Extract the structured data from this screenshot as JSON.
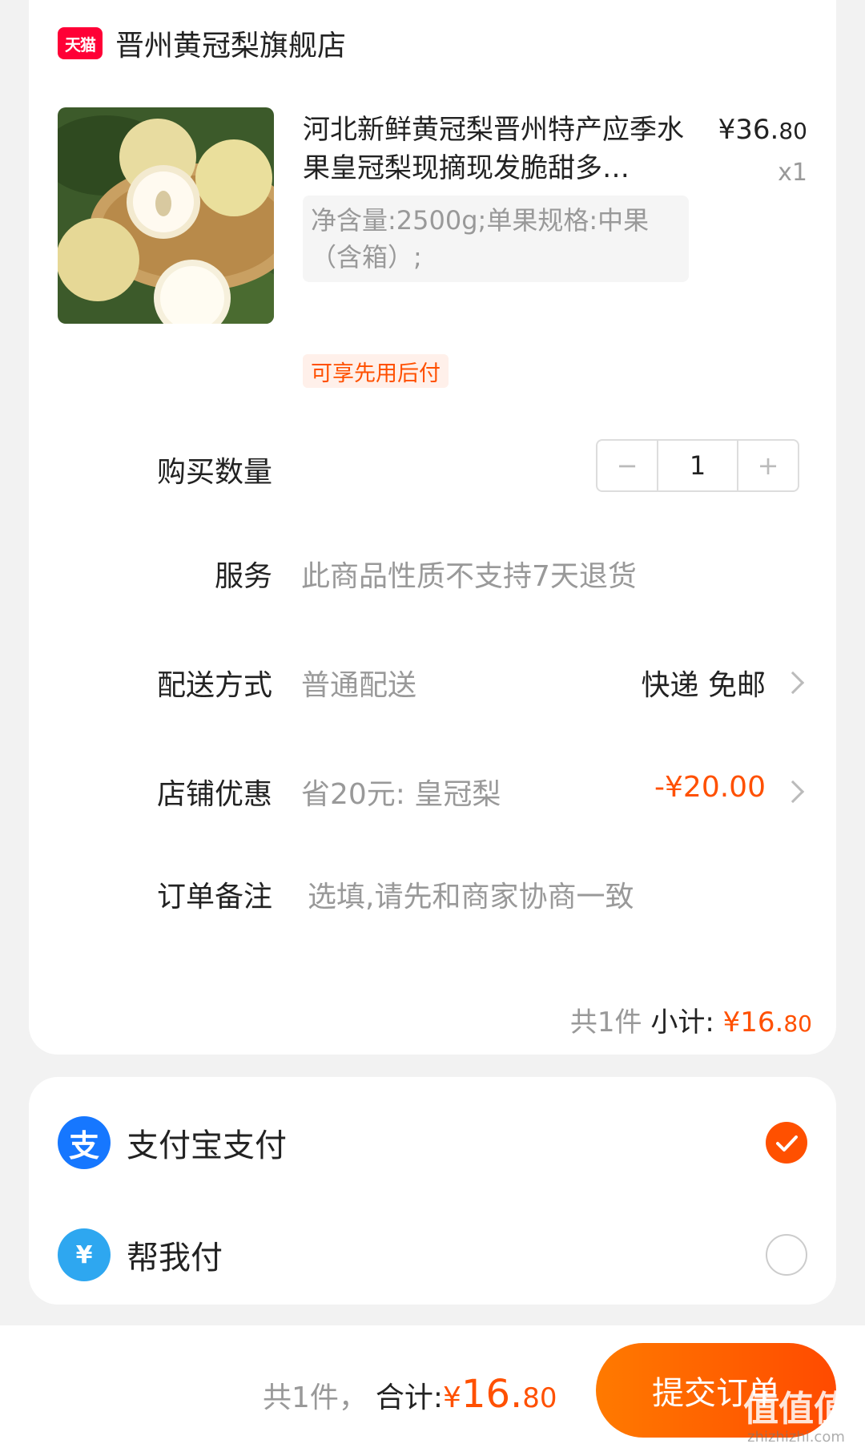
{
  "store": {
    "logo_text": "天猫",
    "name": "晋州黄冠梨旗舰店"
  },
  "product": {
    "title": "河北新鲜黄冠梨晋州特产应季水果皇冠梨现摘现发脆甜多…",
    "spec": "净含量:2500g;单果规格:中果（含箱）;",
    "price_main": "¥36.",
    "price_cents": "80",
    "quantity_label": "x1",
    "badge": "可享先用后付"
  },
  "rows": {
    "quantity": {
      "label": "购买数量",
      "value": "1",
      "minus": "−",
      "plus": "+"
    },
    "service": {
      "label": "服务",
      "value": "此商品性质不支持7天退货"
    },
    "delivery": {
      "label": "配送方式",
      "value": "普通配送",
      "right": "快递 免邮"
    },
    "coupon": {
      "label": "店铺优惠",
      "value": "省20元: 皇冠梨",
      "right": "-¥20.00"
    },
    "note": {
      "label": "订单备注",
      "placeholder": "选填,请先和商家协商一致"
    }
  },
  "subtotal": {
    "count": "共1件",
    "label": "小计:",
    "price_main": "¥16.",
    "price_cents": "80"
  },
  "payment": [
    {
      "icon_char": "支",
      "label": "支付宝支付",
      "selected": true,
      "color": "#1677ff"
    },
    {
      "icon_char": "¥",
      "label": "帮我付",
      "selected": false,
      "color": "#2ea7f0"
    }
  ],
  "bottom": {
    "count": "共1件，",
    "total_label": "合计:",
    "yen": "¥",
    "total_int": "16.",
    "total_cents": "80",
    "submit": "提交订单"
  },
  "watermark": {
    "text": "值值值",
    "sub": "zhizhizhi.com"
  },
  "colors": {
    "accent": "#ff5000",
    "tmall": "#ff0036"
  }
}
